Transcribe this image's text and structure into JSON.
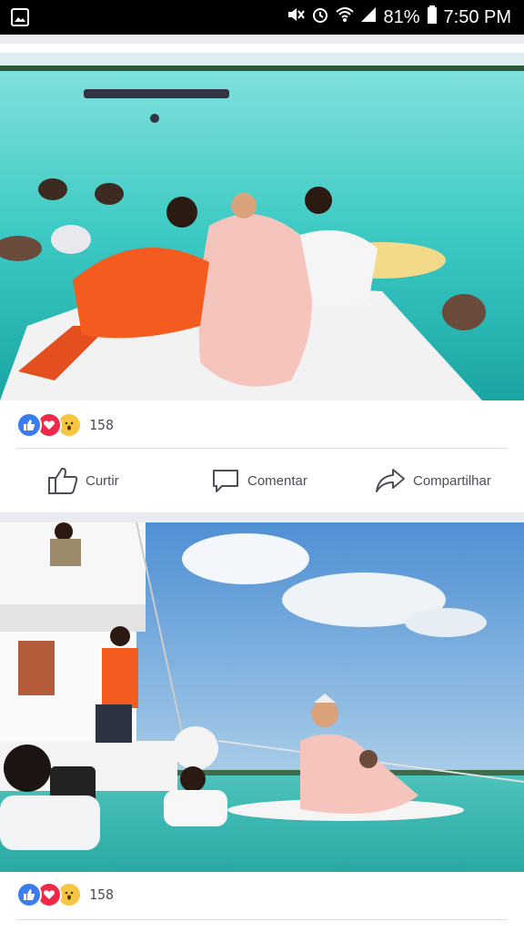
{
  "status_bar": {
    "left_icon": "gallery-icon",
    "battery": "81%",
    "time": "7:50 PM",
    "icons": [
      "mute-icon",
      "alarm-icon",
      "wifi-icon",
      "signal-icon",
      "battery-icon"
    ]
  },
  "posts": [
    {
      "photo": {
        "description": "wedding-on-a-boat-in-turquoise-water"
      },
      "reactions": {
        "types": [
          "like",
          "love",
          "wow"
        ],
        "count": "158"
      },
      "actions": {
        "like": "Curtir",
        "comment": "Comentar",
        "share": "Compartilhar"
      }
    },
    {
      "photo": {
        "description": "bride-on-paddleboard-near-yacht"
      },
      "reactions": {
        "types": [
          "like",
          "love",
          "wow"
        ],
        "count": "158"
      }
    }
  ],
  "colors": {
    "like_blue": "#3b7cf0",
    "love_red": "#f0284a",
    "wow_yellow": "#f7c53f",
    "text_gray": "#4b4f56",
    "feed_bg": "#e9ebee"
  }
}
